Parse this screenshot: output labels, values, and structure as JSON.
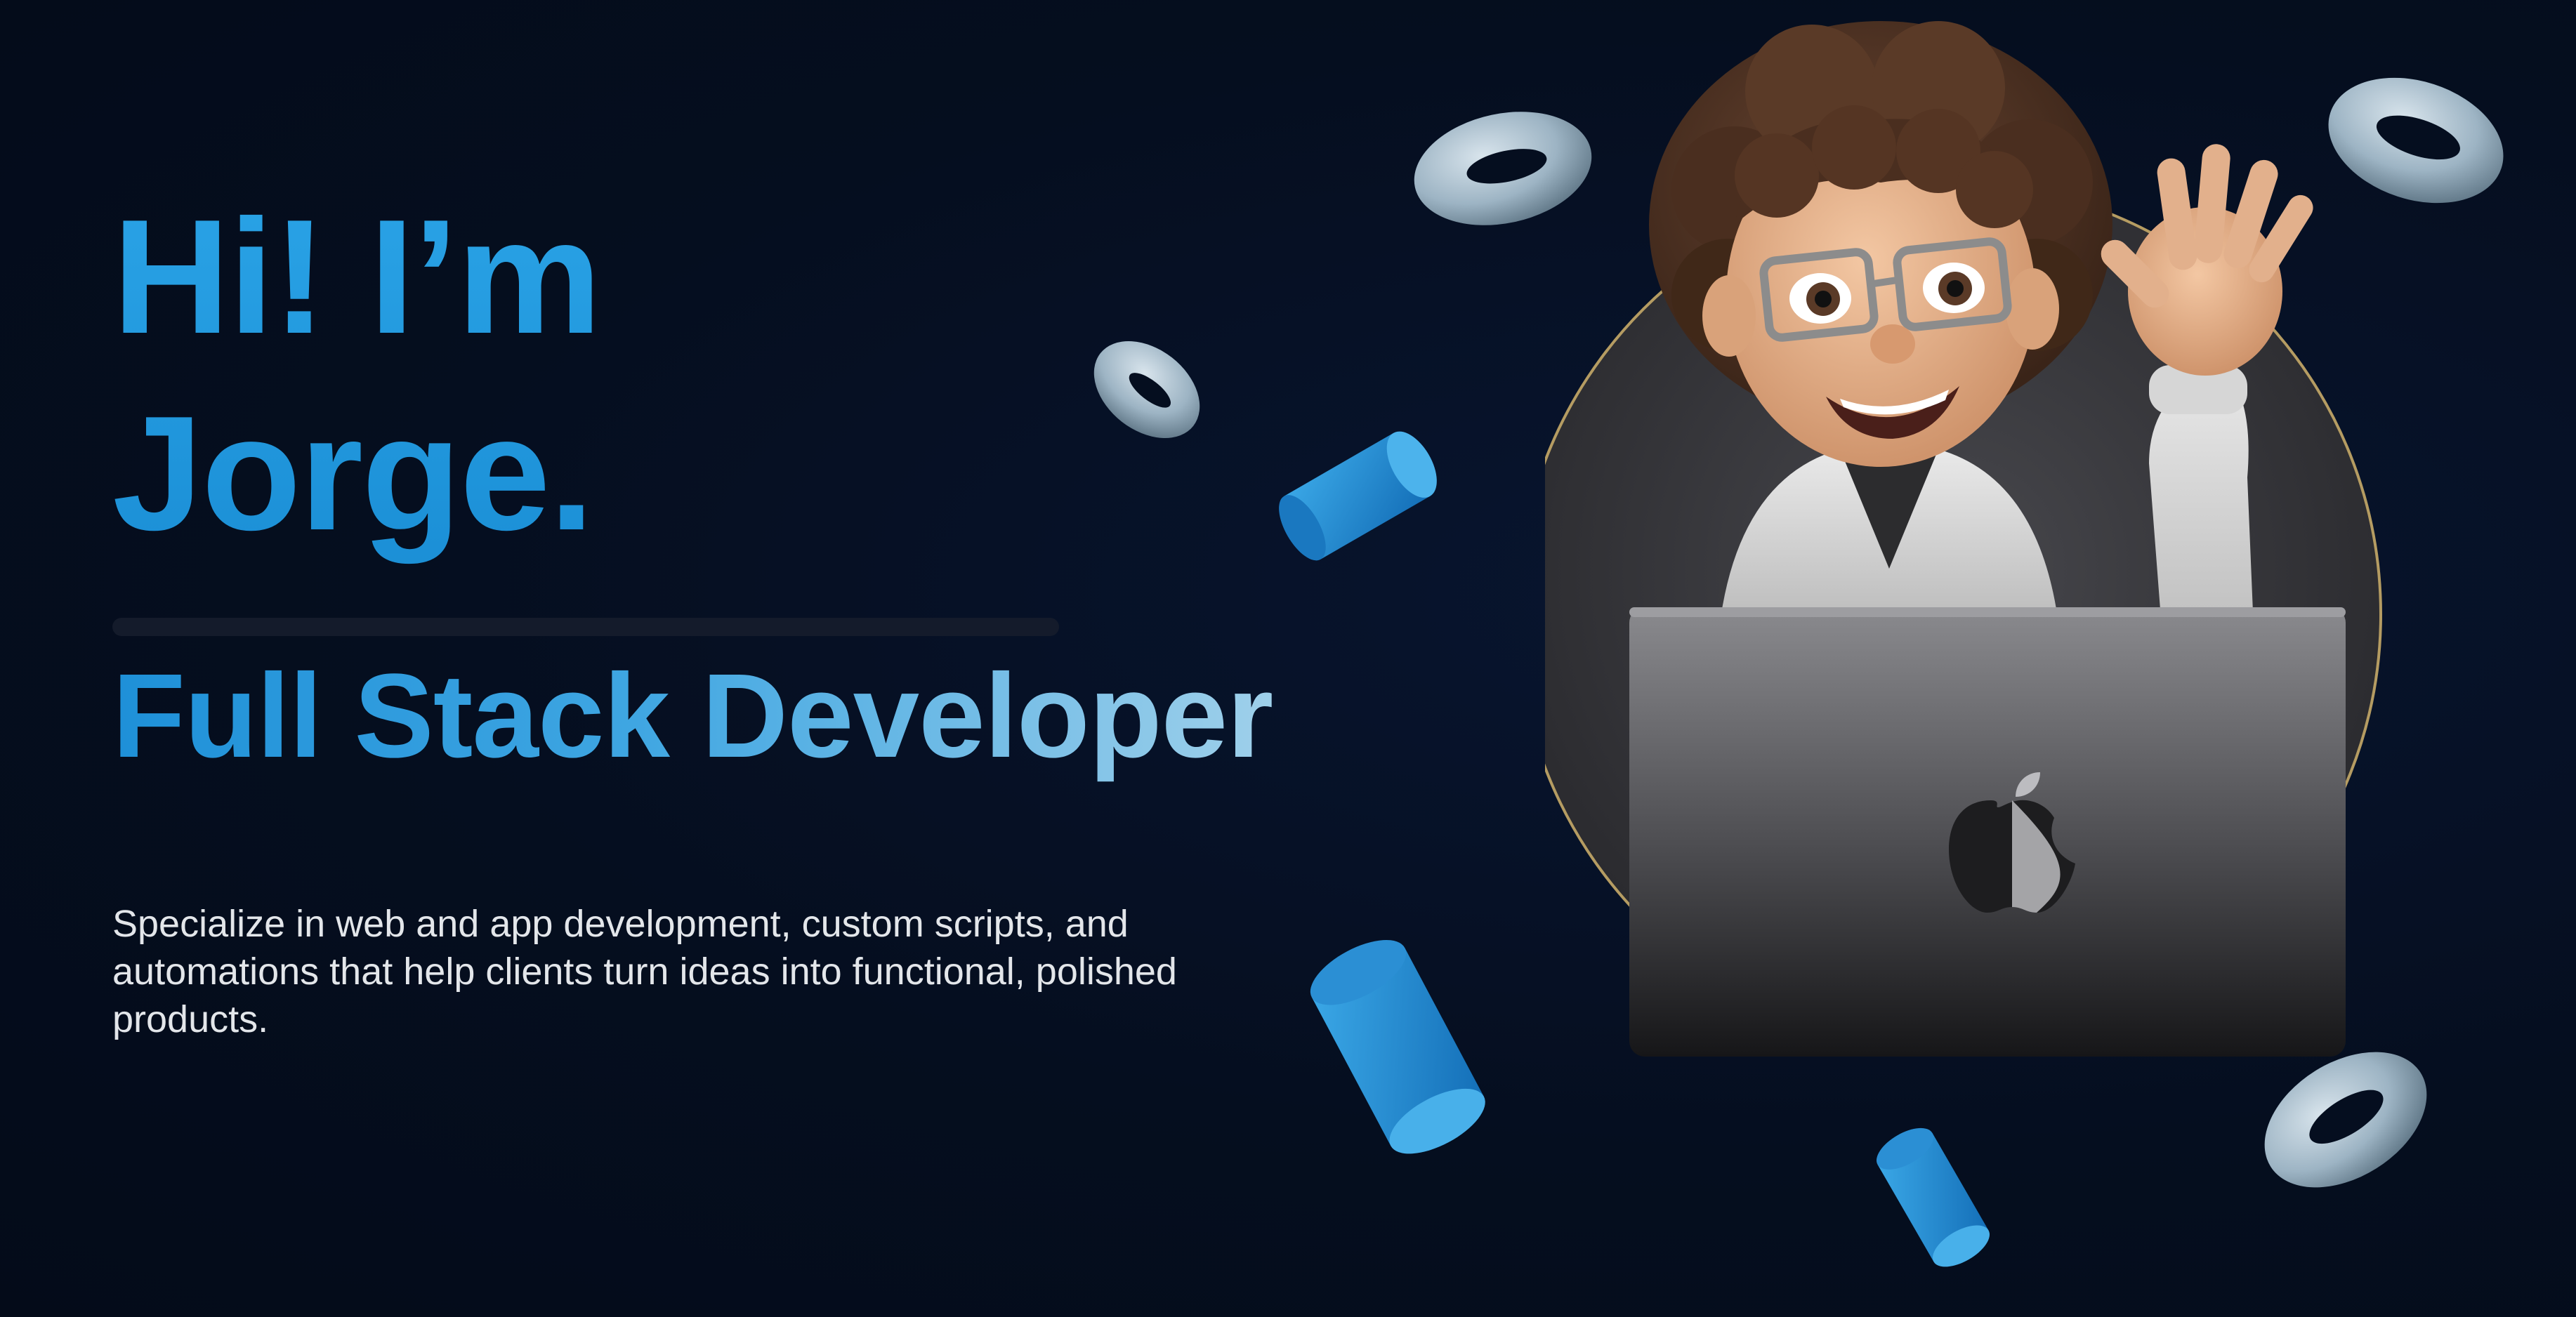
{
  "hero": {
    "greeting_line1": "Hi! I’m",
    "greeting_line2": "Jorge.",
    "role": "Full Stack Developer",
    "summary": "Specialize in web and app development, custom scripts, and automations that help clients turn ideas into functional, polished products."
  },
  "decor": {
    "avatar_icon": "memoji-waving-with-laptop",
    "laptop_logo_icon": "apple-logo-icon",
    "torus_icon": "torus-shape-icon",
    "cylinder_icon": "cylinder-shape-icon"
  },
  "colors": {
    "background": "#050e1f",
    "accent_blue": "#1b8fd6",
    "accent_light": "#9fd0ea",
    "text_body": "#e3e6ea"
  }
}
